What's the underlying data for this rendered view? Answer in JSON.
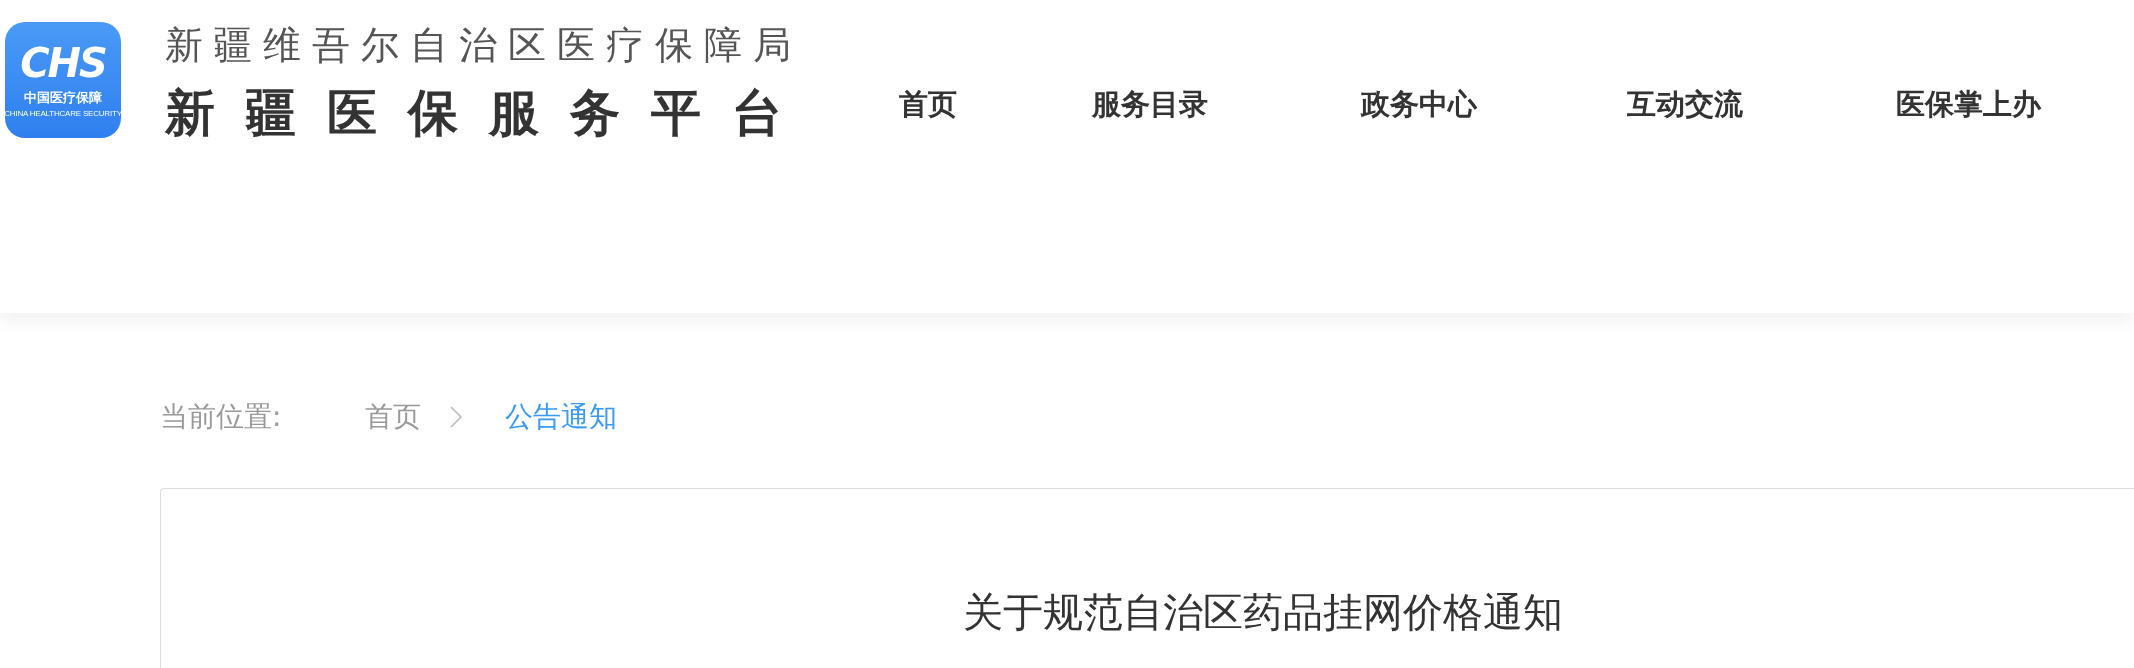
{
  "logo": {
    "mark": "CHS",
    "name": "中国医疗保障",
    "subtitle": "CHINA HEALTHCARE SECURITY"
  },
  "header": {
    "agency": "新疆维吾尔自治区医疗保障局",
    "platform": "新疆医保服务平台"
  },
  "nav": [
    {
      "label": "首页"
    },
    {
      "label": "服务目录"
    },
    {
      "label": "政务中心"
    },
    {
      "label": "互动交流"
    },
    {
      "label": "医保掌上办"
    }
  ],
  "breadcrumb": {
    "label": "当前位置:",
    "items": [
      {
        "label": "首页",
        "selected": false
      },
      {
        "label": "公告通知",
        "selected": true
      }
    ]
  },
  "article": {
    "title": "关于规范自治区药品挂网价格通知"
  }
}
